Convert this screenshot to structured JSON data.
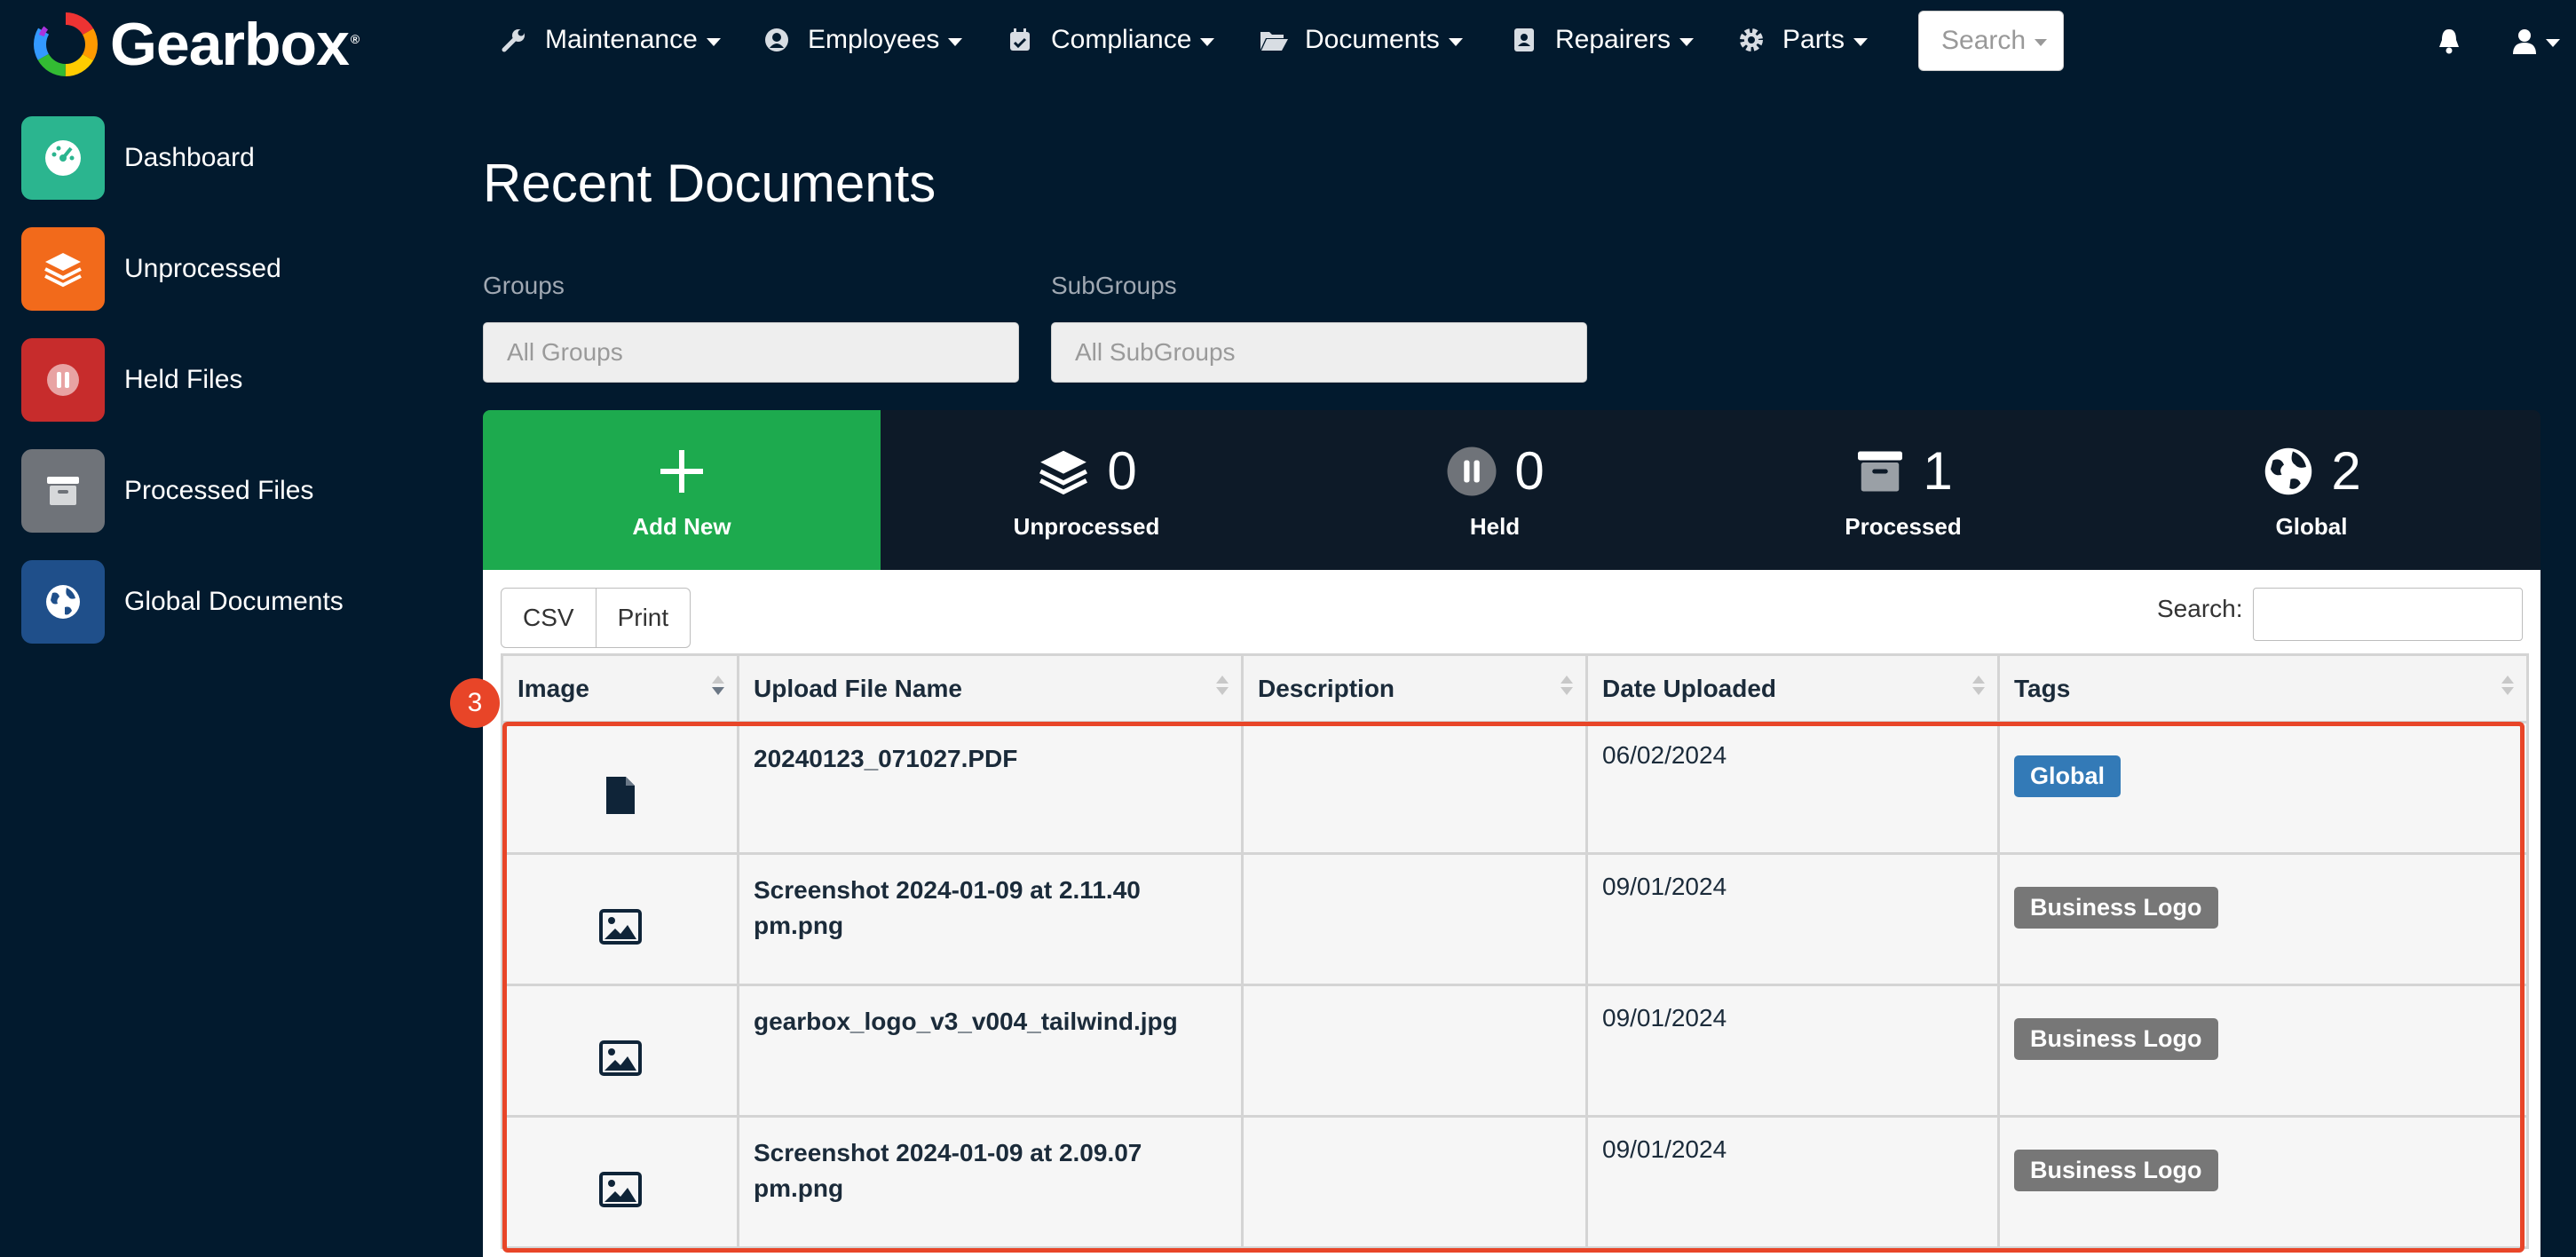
{
  "app": {
    "name": "Gearbox",
    "registered_mark": "®"
  },
  "nav": {
    "items": [
      {
        "label": "Maintenance",
        "icon": "wrench-icon"
      },
      {
        "label": "Employees",
        "icon": "user-circle-icon"
      },
      {
        "label": "Compliance",
        "icon": "calendar-check-icon"
      },
      {
        "label": "Documents",
        "icon": "folder-open-icon"
      },
      {
        "label": "Repairers",
        "icon": "id-card-icon"
      },
      {
        "label": "Parts",
        "icon": "gear-icon"
      }
    ],
    "search_label": "Search"
  },
  "sidebar": {
    "items": [
      {
        "label": "Dashboard",
        "icon": "dashboard-gauge-icon",
        "color": "#2bb58f"
      },
      {
        "label": "Unprocessed",
        "icon": "layers-icon",
        "color": "#f26a1b"
      },
      {
        "label": "Held Files",
        "icon": "pause-icon",
        "color": "#c72c2c"
      },
      {
        "label": "Processed Files",
        "icon": "archive-icon",
        "color": "#6f7379"
      },
      {
        "label": "Global Documents",
        "icon": "globe-icon",
        "color": "#1f4f8a"
      }
    ]
  },
  "main": {
    "title": "Recent Documents",
    "groups": {
      "label": "Groups",
      "placeholder": "All Groups"
    },
    "subgroups": {
      "label": "SubGroups",
      "placeholder": "All SubGroups"
    },
    "stats": {
      "add_new": "Add New",
      "items": [
        {
          "label": "Unprocessed",
          "count": "0"
        },
        {
          "label": "Held",
          "count": "0"
        },
        {
          "label": "Processed",
          "count": "1"
        },
        {
          "label": "Global",
          "count": "2"
        }
      ]
    },
    "table": {
      "buttons": [
        "CSV",
        "Print"
      ],
      "search_label": "Search:",
      "columns": [
        "Image",
        "Upload File Name",
        "Description",
        "Date Uploaded",
        "Tags"
      ],
      "rows": [
        {
          "icon": "file-icon",
          "file_name": "20240123_071027.PDF",
          "description": "",
          "date": "06/02/2024",
          "tag": "Global",
          "tag_color": "#337ab7"
        },
        {
          "icon": "image-icon",
          "file_name": "Screenshot 2024-01-09 at 2.11.40 pm.png",
          "description": "",
          "date": "09/01/2024",
          "tag": "Business Logo",
          "tag_color": "#777777"
        },
        {
          "icon": "image-icon",
          "file_name": "gearbox_logo_v3_v004_tailwind.jpg",
          "description": "",
          "date": "09/01/2024",
          "tag": "Business Logo",
          "tag_color": "#777777"
        },
        {
          "icon": "image-icon",
          "file_name": "Screenshot 2024-01-09 at 2.09.07 pm.png",
          "description": "",
          "date": "09/01/2024",
          "tag": "Business Logo",
          "tag_color": "#777777"
        }
      ]
    },
    "annotation_marker": "3"
  }
}
